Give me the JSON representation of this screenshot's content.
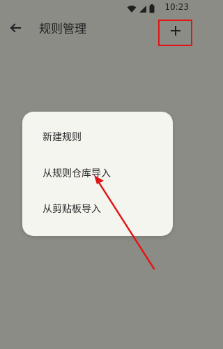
{
  "status_bar": {
    "time": "10:23",
    "icons": [
      "wifi-icon",
      "signal-icon",
      "battery-icon"
    ]
  },
  "app_bar": {
    "back_icon": "back-arrow-icon",
    "title": "规则管理",
    "add_icon": "plus-icon",
    "add_symbol": "+"
  },
  "menu": {
    "items": [
      {
        "label": "新建规则"
      },
      {
        "label": "从规则仓库导入"
      },
      {
        "label": "从剪贴板导入"
      }
    ]
  },
  "colors": {
    "background": "#8b8c85",
    "menu_background": "#f4f5ef",
    "highlight": "#e01616"
  }
}
